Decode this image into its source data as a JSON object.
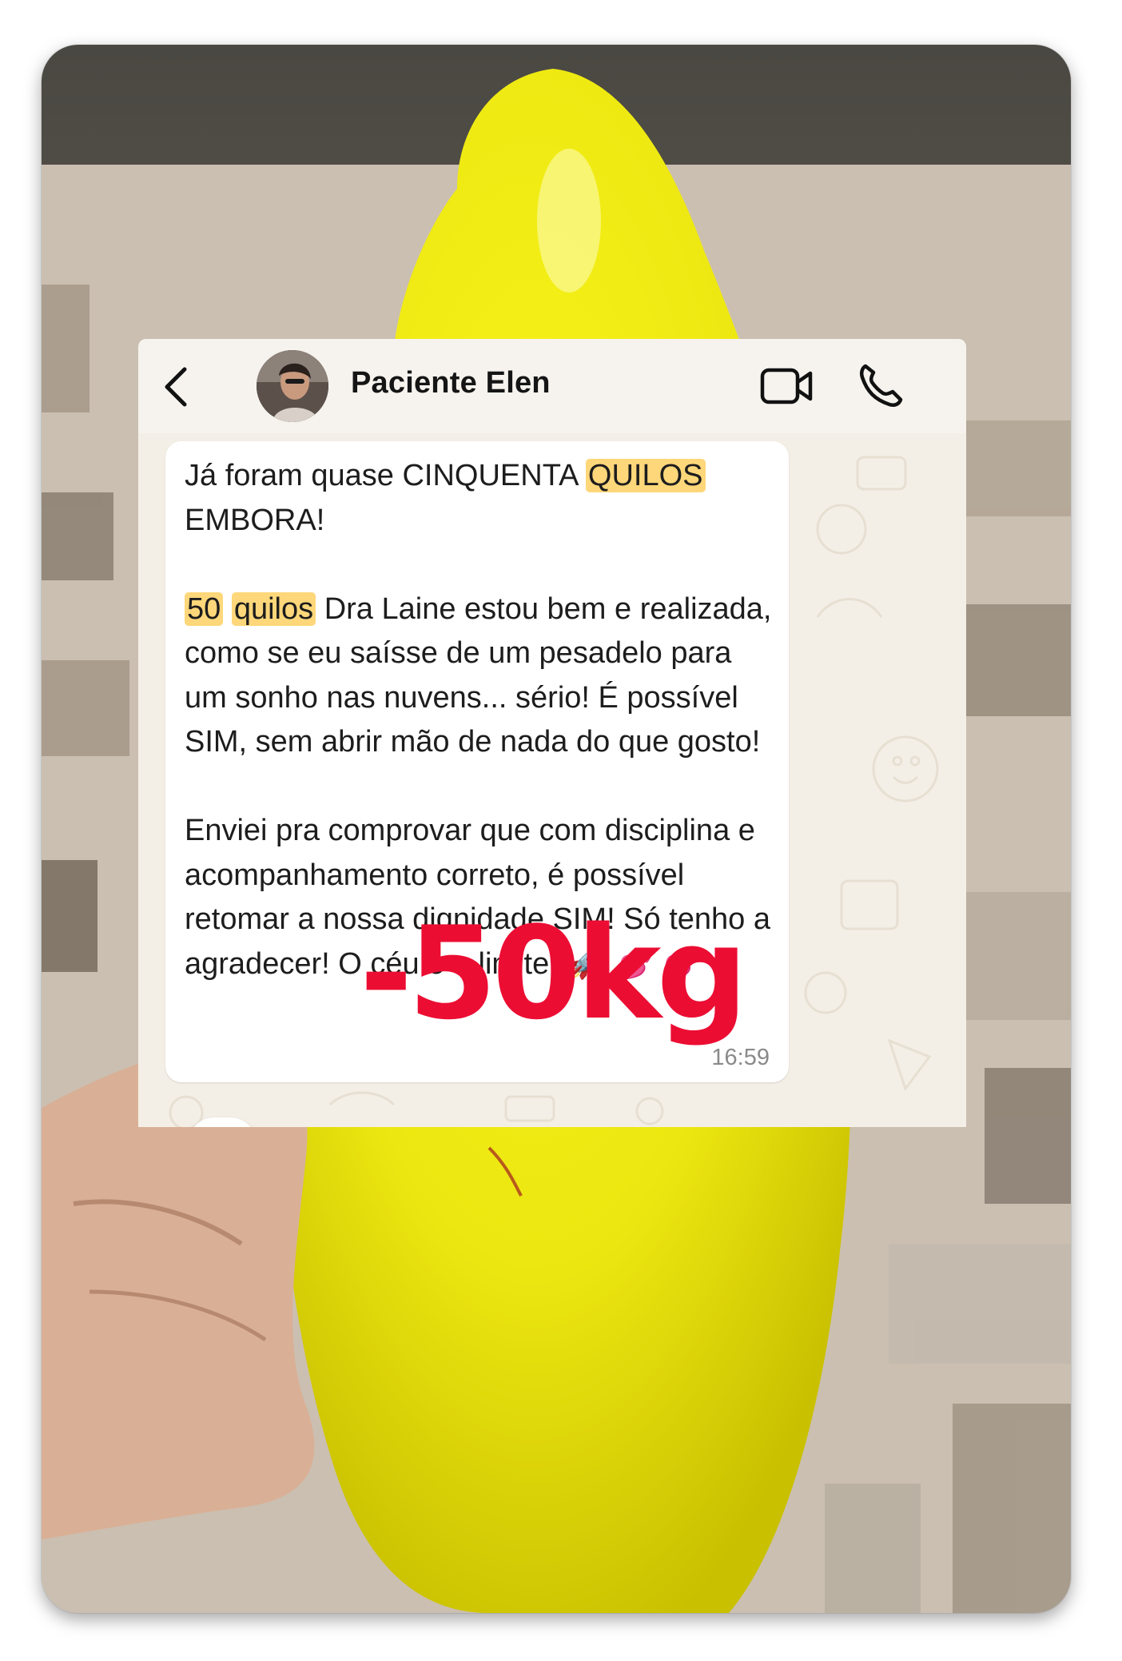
{
  "header": {
    "contact_name": "Paciente Elen",
    "back_icon": "chevron-left-icon",
    "video_icon": "video-camera-icon",
    "call_icon": "phone-icon"
  },
  "message": {
    "p1_a": "Já foram quase CINQUENTA ",
    "p1_hl": "QUILOS",
    "p1_b": "EMBORA!",
    "p2_hl1": "50",
    "p2_hl2": "quilos",
    "p2_rest": " Dra Laine estou bem e realizada, como se eu saísse de um pesadelo para um sonho nas nuvens... sério! É possível SIM, sem abrir mão de nada do que gosto!",
    "p3": "Enviei pra comprovar que com disciplina e acompanhamento correto, é possível retomar a nossa dignidade SIM! Só tenho a agradecer! O céu é o limite! ",
    "emoji_rocket": "🚀",
    "emoji_hearts": "💕 💕",
    "time": "16:59"
  },
  "reaction": {
    "emoji": "❤"
  },
  "overlay": {
    "text": "-50kg"
  },
  "colors": {
    "highlight": "#fdd77a",
    "overlay_text": "#ec0d33",
    "papaya": "#f2ee0c",
    "chat_bg": "#f4efe6"
  }
}
